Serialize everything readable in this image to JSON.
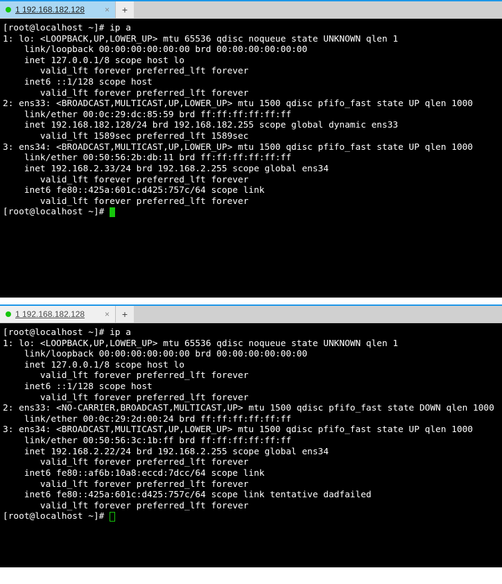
{
  "top": {
    "tab": {
      "title": "1 192.168.182.128",
      "close": "×"
    },
    "new_tab": "+",
    "prompt_user": "[root@localhost ~]# ",
    "command": "ip a",
    "output": [
      "1: lo: <LOOPBACK,UP,LOWER_UP> mtu 65536 qdisc noqueue state UNKNOWN qlen 1",
      "    link/loopback 00:00:00:00:00:00 brd 00:00:00:00:00:00",
      "    inet 127.0.0.1/8 scope host lo",
      "       valid_lft forever preferred_lft forever",
      "    inet6 ::1/128 scope host",
      "       valid_lft forever preferred_lft forever",
      "2: ens33: <BROADCAST,MULTICAST,UP,LOWER_UP> mtu 1500 qdisc pfifo_fast state UP qlen 1000",
      "    link/ether 00:0c:29:dc:85:59 brd ff:ff:ff:ff:ff:ff",
      "    inet 192.168.182.128/24 brd 192.168.182.255 scope global dynamic ens33",
      "       valid_lft 1589sec preferred_lft 1589sec",
      "3: ens34: <BROADCAST,MULTICAST,UP,LOWER_UP> mtu 1500 qdisc pfifo_fast state UP qlen 1000",
      "    link/ether 00:50:56:2b:db:11 brd ff:ff:ff:ff:ff:ff",
      "    inet 192.168.2.33/24 brd 192.168.2.255 scope global ens34",
      "       valid_lft forever preferred_lft forever",
      "    inet6 fe80::425a:601c:d425:757c/64 scope link",
      "       valid_lft forever preferred_lft forever"
    ],
    "prompt2": "[root@localhost ~]# "
  },
  "bottom": {
    "tab": {
      "title": "1 192.168.182.128",
      "close": "×"
    },
    "new_tab": "+",
    "prompt_user": "[root@localhost ~]# ",
    "command": "ip a",
    "output": [
      "1: lo: <LOOPBACK,UP,LOWER_UP> mtu 65536 qdisc noqueue state UNKNOWN qlen 1",
      "    link/loopback 00:00:00:00:00:00 brd 00:00:00:00:00:00",
      "    inet 127.0.0.1/8 scope host lo",
      "       valid_lft forever preferred_lft forever",
      "    inet6 ::1/128 scope host",
      "       valid_lft forever preferred_lft forever",
      "2: ens33: <NO-CARRIER,BROADCAST,MULTICAST,UP> mtu 1500 qdisc pfifo_fast state DOWN qlen 1000",
      "    link/ether 00:0c:29:2d:00:24 brd ff:ff:ff:ff:ff:ff",
      "3: ens34: <BROADCAST,MULTICAST,UP,LOWER_UP> mtu 1500 qdisc pfifo_fast state UP qlen 1000",
      "    link/ether 00:50:56:3c:1b:ff brd ff:ff:ff:ff:ff:ff",
      "    inet 192.168.2.22/24 brd 192.168.2.255 scope global ens34",
      "       valid_lft forever preferred_lft forever",
      "    inet6 fe80::af6b:10a8:eccd:7dcc/64 scope link",
      "       valid_lft forever preferred_lft forever",
      "    inet6 fe80::425a:601c:d425:757c/64 scope link tentative dadfailed",
      "       valid_lft forever preferred_lft forever"
    ],
    "prompt2": "[root@localhost ~]# "
  }
}
